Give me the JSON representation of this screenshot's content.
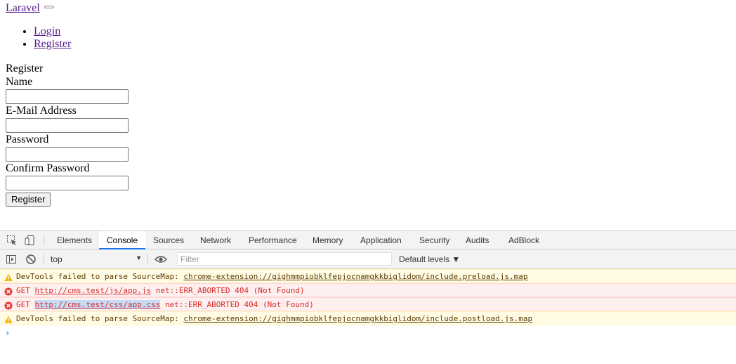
{
  "page": {
    "brand": "Laravel",
    "nav": {
      "login": "Login",
      "register": "Register"
    },
    "form": {
      "heading": "Register",
      "name_label": "Name",
      "email_label": "E-Mail Address",
      "password_label": "Password",
      "confirm_label": "Confirm Password",
      "submit": "Register"
    }
  },
  "devtools": {
    "tabs": [
      "Elements",
      "Console",
      "Sources",
      "Network",
      "Performance",
      "Memory",
      "Application",
      "Security",
      "Audits",
      "AdBlock"
    ],
    "active_tab": "Console",
    "context": "top",
    "filter_placeholder": "Filter",
    "levels": "Default levels ▼",
    "messages": [
      {
        "level": "warning",
        "prefix": "DevTools failed to parse SourceMap:",
        "url": "chrome-extension://gighmmpiobklfepjocnamgkkbiglidom/include.preload.js.map",
        "suffix": ""
      },
      {
        "level": "error",
        "prefix": "GET",
        "url": "http://cms.test/js/app.js",
        "suffix": "net::ERR_ABORTED 404 (Not Found)"
      },
      {
        "level": "error",
        "prefix": "GET",
        "url": "http://cms.test/css/app.css",
        "suffix": "net::ERR_ABORTED 404 (Not Found)"
      },
      {
        "level": "warning",
        "prefix": "DevTools failed to parse SourceMap:",
        "url": "chrome-extension://gighmmpiobklfepjocnamgkkbiglidom/include.postload.js.map",
        "suffix": ""
      }
    ],
    "prompt": "›",
    "colors": {
      "active_tab": "#1a73e8",
      "error_text": "#d72b2b",
      "warning_bg": "#fffbe5",
      "error_bg": "#fff0f0"
    }
  }
}
